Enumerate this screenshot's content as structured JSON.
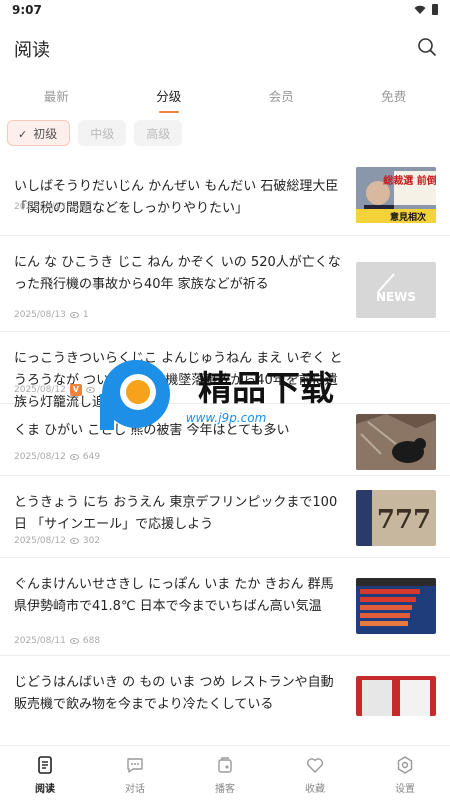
{
  "status": {
    "time": "9:07"
  },
  "header": {
    "title": "阅读"
  },
  "level_tabs": [
    {
      "label": "最新"
    },
    {
      "label": "分级",
      "active": true
    },
    {
      "label": "会员"
    },
    {
      "label": "免费"
    }
  ],
  "chips": [
    {
      "label": "初级",
      "active": true
    },
    {
      "label": "中级"
    },
    {
      "label": "高级"
    }
  ],
  "news": [
    {
      "title": "いしばそうりだいじん かんぜい もんだい 石破総理大臣「関税の問題などをしっかりやりたい」",
      "date": "2025/08/13",
      "views": "4"
    },
    {
      "title": "にん な ひこうき じこ ねん かぞく いの 520人が亡くなった飛行機の事故から40年 家族などが祈る",
      "date": "2025/08/13",
      "views": "1"
    },
    {
      "title": "にっこうきついらくじこ よんじゅうねん まえ いぞく とうろうなが ついとう 日航機墜落事故から40年を前に遺族ら灯籠流し追悼",
      "date": "2025/08/12",
      "views": "",
      "badge": "V"
    },
    {
      "title": "くま ひがい ことし 熊の被害 今年はとても多い",
      "date": "2025/08/12",
      "views": "649"
    },
    {
      "title": "とうきょう にち おうえん 東京デフリンピックまで100日 「サインエール」で応援しよう",
      "date": "2025/08/12",
      "views": "302"
    },
    {
      "title": "ぐんまけんいせさきし にっぽん いま たか きおん 群馬県伊勢崎市で41.8℃ 日本で今までいちばん高い気温",
      "date": "2025/08/11",
      "views": "688"
    },
    {
      "title": "じどうはんばいき の もの いま つめ レストランや自動販売機で飲み物を今までより冷たくしている",
      "date": "",
      "views": ""
    }
  ],
  "thumbs": {
    "t1_caption": "総裁選 前倒し",
    "t1_sub": "意見相次",
    "t2_caption": "NEWS",
    "t3_caption": "777"
  },
  "watermark": {
    "title": "精品下载",
    "url": "www.j9p.com"
  },
  "bottom_nav": [
    {
      "label": "阅读",
      "active": true
    },
    {
      "label": "对话"
    },
    {
      "label": "播客"
    },
    {
      "label": "收藏"
    },
    {
      "label": "设置"
    }
  ],
  "colors": {
    "accent": "#f0843c",
    "chip_active_bg": "#fdf0ec",
    "watermark_blue": "#1e8fe6"
  }
}
